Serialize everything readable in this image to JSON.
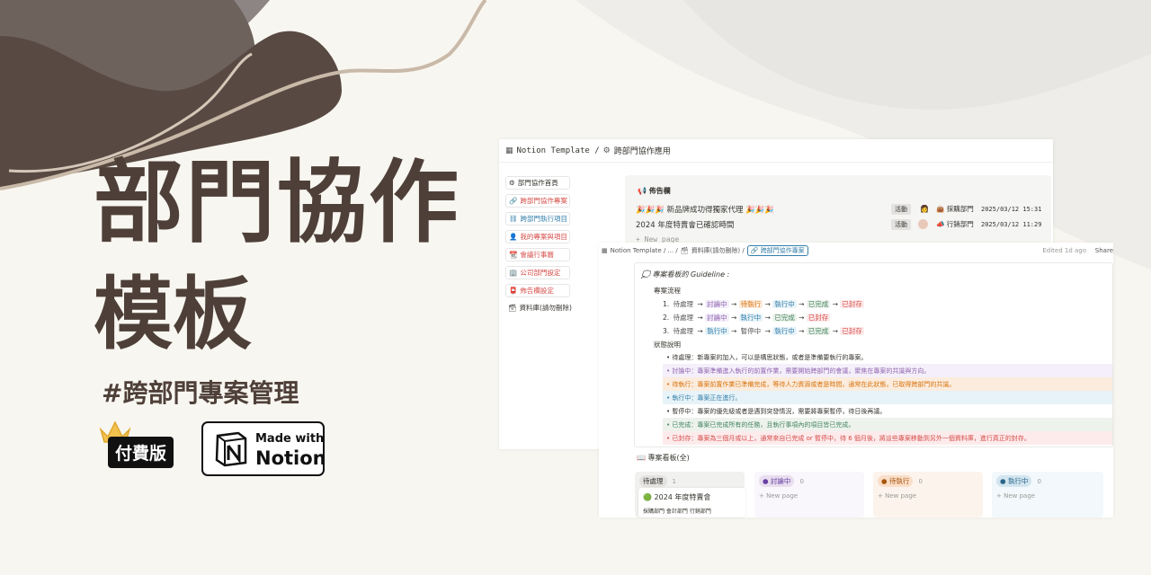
{
  "hero": {
    "title_line1": "部門協作",
    "title_line2": "模板",
    "hashtag": "#跨部門專案管理",
    "paid_label": "付費版",
    "badge_made_with": "Made with",
    "badge_notion": "Notion"
  },
  "window1": {
    "breadcrumb_root": "Notion Template /",
    "breadcrumb_page": "跨部門協作應用",
    "sidebar": [
      {
        "icon": "gear-icon",
        "label": "部門協作首頁",
        "style": "plain"
      },
      {
        "icon": "link-icon",
        "label": "跨部門協作專案",
        "style": "red"
      },
      {
        "icon": "chain-icon",
        "label": "跨部門執行項目",
        "style": "blue"
      },
      {
        "icon": "person-icon",
        "label": "我的專案與項目",
        "style": "red"
      },
      {
        "icon": "calendar-icon",
        "label": "會議行事曆",
        "style": "red"
      },
      {
        "icon": "building-icon",
        "label": "公司部門設定",
        "style": "red"
      },
      {
        "icon": "mailbox-icon",
        "label": "佈告欄設定",
        "style": "red"
      },
      {
        "icon": "archive-icon",
        "label": "資料庫(請勿刪除)",
        "style": "none"
      }
    ],
    "bulletin": {
      "heading": "佈告欄",
      "rows": [
        {
          "title": "🎉🎉🎉 新品牌成功得獨家代理 🎉🎉🎉",
          "type": "活動",
          "department": "採購部門",
          "date": "2025/03/12 15:31"
        },
        {
          "title": "2024 年度特賣會已確認時間",
          "type": "活動",
          "department": "行銷部門",
          "date": "2025/03/12 11:29"
        }
      ],
      "new_page": "+ New page"
    }
  },
  "window2": {
    "breadcrumb_root": "Notion Template / ... /",
    "breadcrumb_mid": "資料庫(請勿刪除) /",
    "breadcrumb_page": "跨部門協作專案",
    "edited": "Edited 1d ago",
    "share": "Share",
    "guideline_title": "專案看板的 Guideline :",
    "flow_heading": "專案流程",
    "flows": [
      {
        "num": "1.",
        "steps": [
          [
            "待處理",
            "gry"
          ],
          [
            "討論中",
            "pur"
          ],
          [
            "待執行",
            "ora"
          ],
          [
            "執行中",
            "blu"
          ],
          [
            "已完成",
            "gre"
          ],
          [
            "已封存",
            "red"
          ]
        ]
      },
      {
        "num": "2.",
        "steps": [
          [
            "待處理",
            "gry"
          ],
          [
            "討論中",
            "pur"
          ],
          [
            "執行中",
            "blu"
          ],
          [
            "已完成",
            "gre"
          ],
          [
            "已封存",
            "red"
          ]
        ]
      },
      {
        "num": "3.",
        "steps": [
          [
            "待處理",
            "gry"
          ],
          [
            "執行中",
            "blu"
          ],
          [
            "暫停中",
            "gry"
          ],
          [
            "執行中",
            "blu"
          ],
          [
            "已完成",
            "gre"
          ],
          [
            "已封存",
            "red"
          ]
        ]
      }
    ],
    "status_heading": "狀態說明",
    "statuses": [
      {
        "text": "待處理：新專案的加入，可以是構思狀態，或者是準備要執行的專案。",
        "tone": "none"
      },
      {
        "text": "討論中：專案準備進入執行的前置作業，需要開始跨部門的會議，聚焦在專案的共識與方向。",
        "tone": "pur"
      },
      {
        "text": "待執行：專案前置作業已準備完成，等待人力資源或者是時間，通常在此狀態，已取得跨部門的共識。",
        "tone": "ora"
      },
      {
        "text": "執行中：專案正在進行。",
        "tone": "blu"
      },
      {
        "text": "暫停中：專案的優先級或者是遇到突發情況，需要將專案暫停，待日後再議。",
        "tone": "gry"
      },
      {
        "text": "已完成：專案已完成所有的任務，且執行事項內的項目皆已完成。",
        "tone": "gre"
      },
      {
        "text": "已封存：專案為三個月或以上，通常來自已完成 or 暫停中，待 6 個月後，將這些專案移動到另外一個資料庫，進行真正的封存。",
        "tone": "red"
      }
    ],
    "board_heading": "專案看板(全)",
    "columns": [
      {
        "label": "待處理",
        "count": "1",
        "tone": "gry",
        "card_title": "2024 年度特賣會",
        "card_depts": "採購部門  會計部門  行銷部門"
      },
      {
        "label": "討論中",
        "count": "0",
        "tone": "pur",
        "new_page": "+ New page"
      },
      {
        "label": "待執行",
        "count": "0",
        "tone": "ora",
        "new_page": "+ New page"
      },
      {
        "label": "執行中",
        "count": "0",
        "tone": "blu",
        "new_page": "+ New page"
      }
    ]
  },
  "colors": {
    "title_brown": "#4e4039",
    "background": "#f8f6f0",
    "wave_dark": "#584a43",
    "wave_gray": "#8c8583"
  }
}
